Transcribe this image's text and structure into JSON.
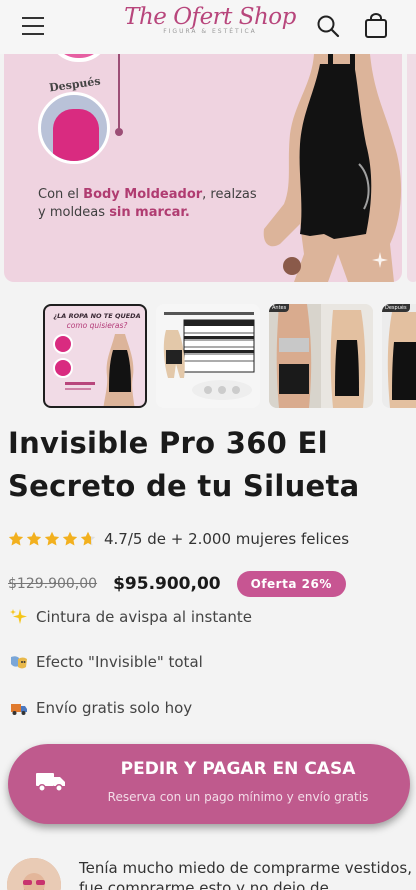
{
  "header": {
    "logo_title": "The Ofert Shop",
    "logo_subtitle": "FIGURA & ESTÉTICA",
    "menu_icon": "hamburger-menu-icon",
    "search_icon": "search-icon",
    "cart_icon": "shopping-bag-icon"
  },
  "hero": {
    "label_after": "Después",
    "text_prefix": "Con el ",
    "text_bold_1": "Body Moldeador",
    "text_mid": ", realzas y moldeas ",
    "text_bold_2": "sin marcar."
  },
  "thumbnails": {
    "t1_title": "¿LA ROPA NO TE QUEDA",
    "t1_sub": "como quisieras?",
    "t3_tag": "Antes",
    "t4_tag": "Después"
  },
  "product": {
    "title": "Invisible Pro 360 El Secreto de tu Silueta",
    "rating_text": "4.7/5 de + 2.000 mujeres felices",
    "rating_value": 4.7,
    "rating_max": 5,
    "price_old": "$129.900,00",
    "price_new": "$95.900,00",
    "badge": "Oferta 26%"
  },
  "benefits": [
    {
      "icon": "sparkles-icon",
      "text": "Cintura de avispa al instante"
    },
    {
      "icon": "magic-mask-icon",
      "text": "Efecto \"Invisible\" total"
    },
    {
      "icon": "delivery-truck-icon",
      "text": "Envío gratis solo hoy"
    }
  ],
  "cta": {
    "main": "PEDIR Y PAGAR EN CASA",
    "sub": "Reserva con un pago mínimo y envío gratis",
    "icon": "delivery-truck-icon"
  },
  "review": {
    "text": "Tenía mucho miedo de comprarme vestidos, fue comprarme esto y no dejo de"
  },
  "colors": {
    "brand": "#b8467c",
    "cta": "#bf5a8d",
    "badge": "#c75592",
    "star": "#f2b01e",
    "hero_bg": "#efd3e0"
  }
}
